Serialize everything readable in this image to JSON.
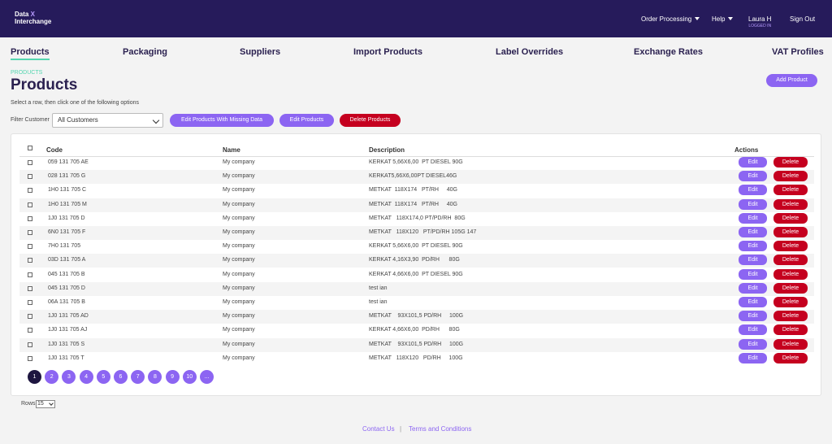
{
  "header": {
    "logo_line1": "Data",
    "logo_x": "X",
    "logo_line2": "Interchange",
    "order_processing": "Order Processing",
    "help": "Help",
    "user_name": "Laura H",
    "user_status": "LOGGED IN",
    "sign_out": "Sign Out"
  },
  "tabs": [
    {
      "label": "Products",
      "active": true
    },
    {
      "label": "Packaging"
    },
    {
      "label": "Suppliers"
    },
    {
      "label": "Import Products"
    },
    {
      "label": "Label Overrides"
    },
    {
      "label": "Exchange Rates"
    },
    {
      "label": "VAT Profiles"
    }
  ],
  "page": {
    "breadcrumb": "PRODUCTS",
    "title": "Products",
    "add_product": "Add Product",
    "hint": "Select a row, then click one of the following options",
    "filter_label": "Filter Customer",
    "filter_value": "All Customers",
    "edit_missing": "Edit Products With Missing Data",
    "edit_products": "Edit Products",
    "delete_products": "Delete Products"
  },
  "table": {
    "columns": {
      "code": "Code",
      "name": "Name",
      "description": "Description",
      "actions": "Actions"
    },
    "edit_label": "Edit",
    "delete_label": "Delete",
    "rows": [
      {
        "code": "059 131 705 AE",
        "name": "My company",
        "description": "KERKAT 5,66X6,00  PT DIESEL 90G"
      },
      {
        "code": "028 131 705 G",
        "name": "My company",
        "description": "KERKAT5,66X6,00PT DIESEL46G"
      },
      {
        "code": "1H0 131 705 C",
        "name": "My company",
        "description": "METKAT  118X174   PT/RH     40G"
      },
      {
        "code": "1H0 131 705 M",
        "name": "My company",
        "description": "METKAT  118X174   PT/RH     40G"
      },
      {
        "code": "1J0 131 705 D",
        "name": "My company",
        "description": "METKAT   118X174,0 PT/PD/RH  80G"
      },
      {
        "code": "6N0 131 705 F",
        "name": "My company",
        "description": "METKAT   118X120   PT/PD/RH 105G 147"
      },
      {
        "code": "7H0 131 705",
        "name": "My company",
        "description": "KERKAT 5,66X6,00  PT DIESEL 90G"
      },
      {
        "code": "03D 131 705 A",
        "name": "My company",
        "description": "KERKAT 4,16X3,90  PD/RH      80G"
      },
      {
        "code": "045 131 705 B",
        "name": "My company",
        "description": "KERKAT 4,66X6,00  PT DIESEL 90G"
      },
      {
        "code": "045 131 705 D",
        "name": "My company",
        "description": "test ian"
      },
      {
        "code": "06A 131 705 B",
        "name": "My company",
        "description": "test ian"
      },
      {
        "code": "1J0 131 705 AD",
        "name": "My company",
        "description": "METKAT    93X101,5 PD/RH     100G"
      },
      {
        "code": "1J0 131 705 AJ",
        "name": "My company",
        "description": "KERKAT 4,66X6,00  PD/RH      80G"
      },
      {
        "code": "1J0 131 705 S",
        "name": "My company",
        "description": "METKAT    93X101,5 PD/RH     100G"
      },
      {
        "code": "1J0 131 705 T",
        "name": "My company",
        "description": "METKAT   118X120   PD/RH     100G"
      }
    ]
  },
  "pagination": {
    "pages": [
      "1",
      "2",
      "3",
      "4",
      "5",
      "6",
      "7",
      "8",
      "9",
      "10",
      "..."
    ],
    "current": "1",
    "rows_label": "Rows",
    "rows_value": "15"
  },
  "footer": {
    "contact": "Contact Us",
    "separator": "|",
    "terms": "Terms and Conditions"
  },
  "colors": {
    "header_bg": "#261b5b",
    "accent_purple": "#8c65f2",
    "danger_red": "#c5001f",
    "tab_underline": "#55d6b0"
  }
}
